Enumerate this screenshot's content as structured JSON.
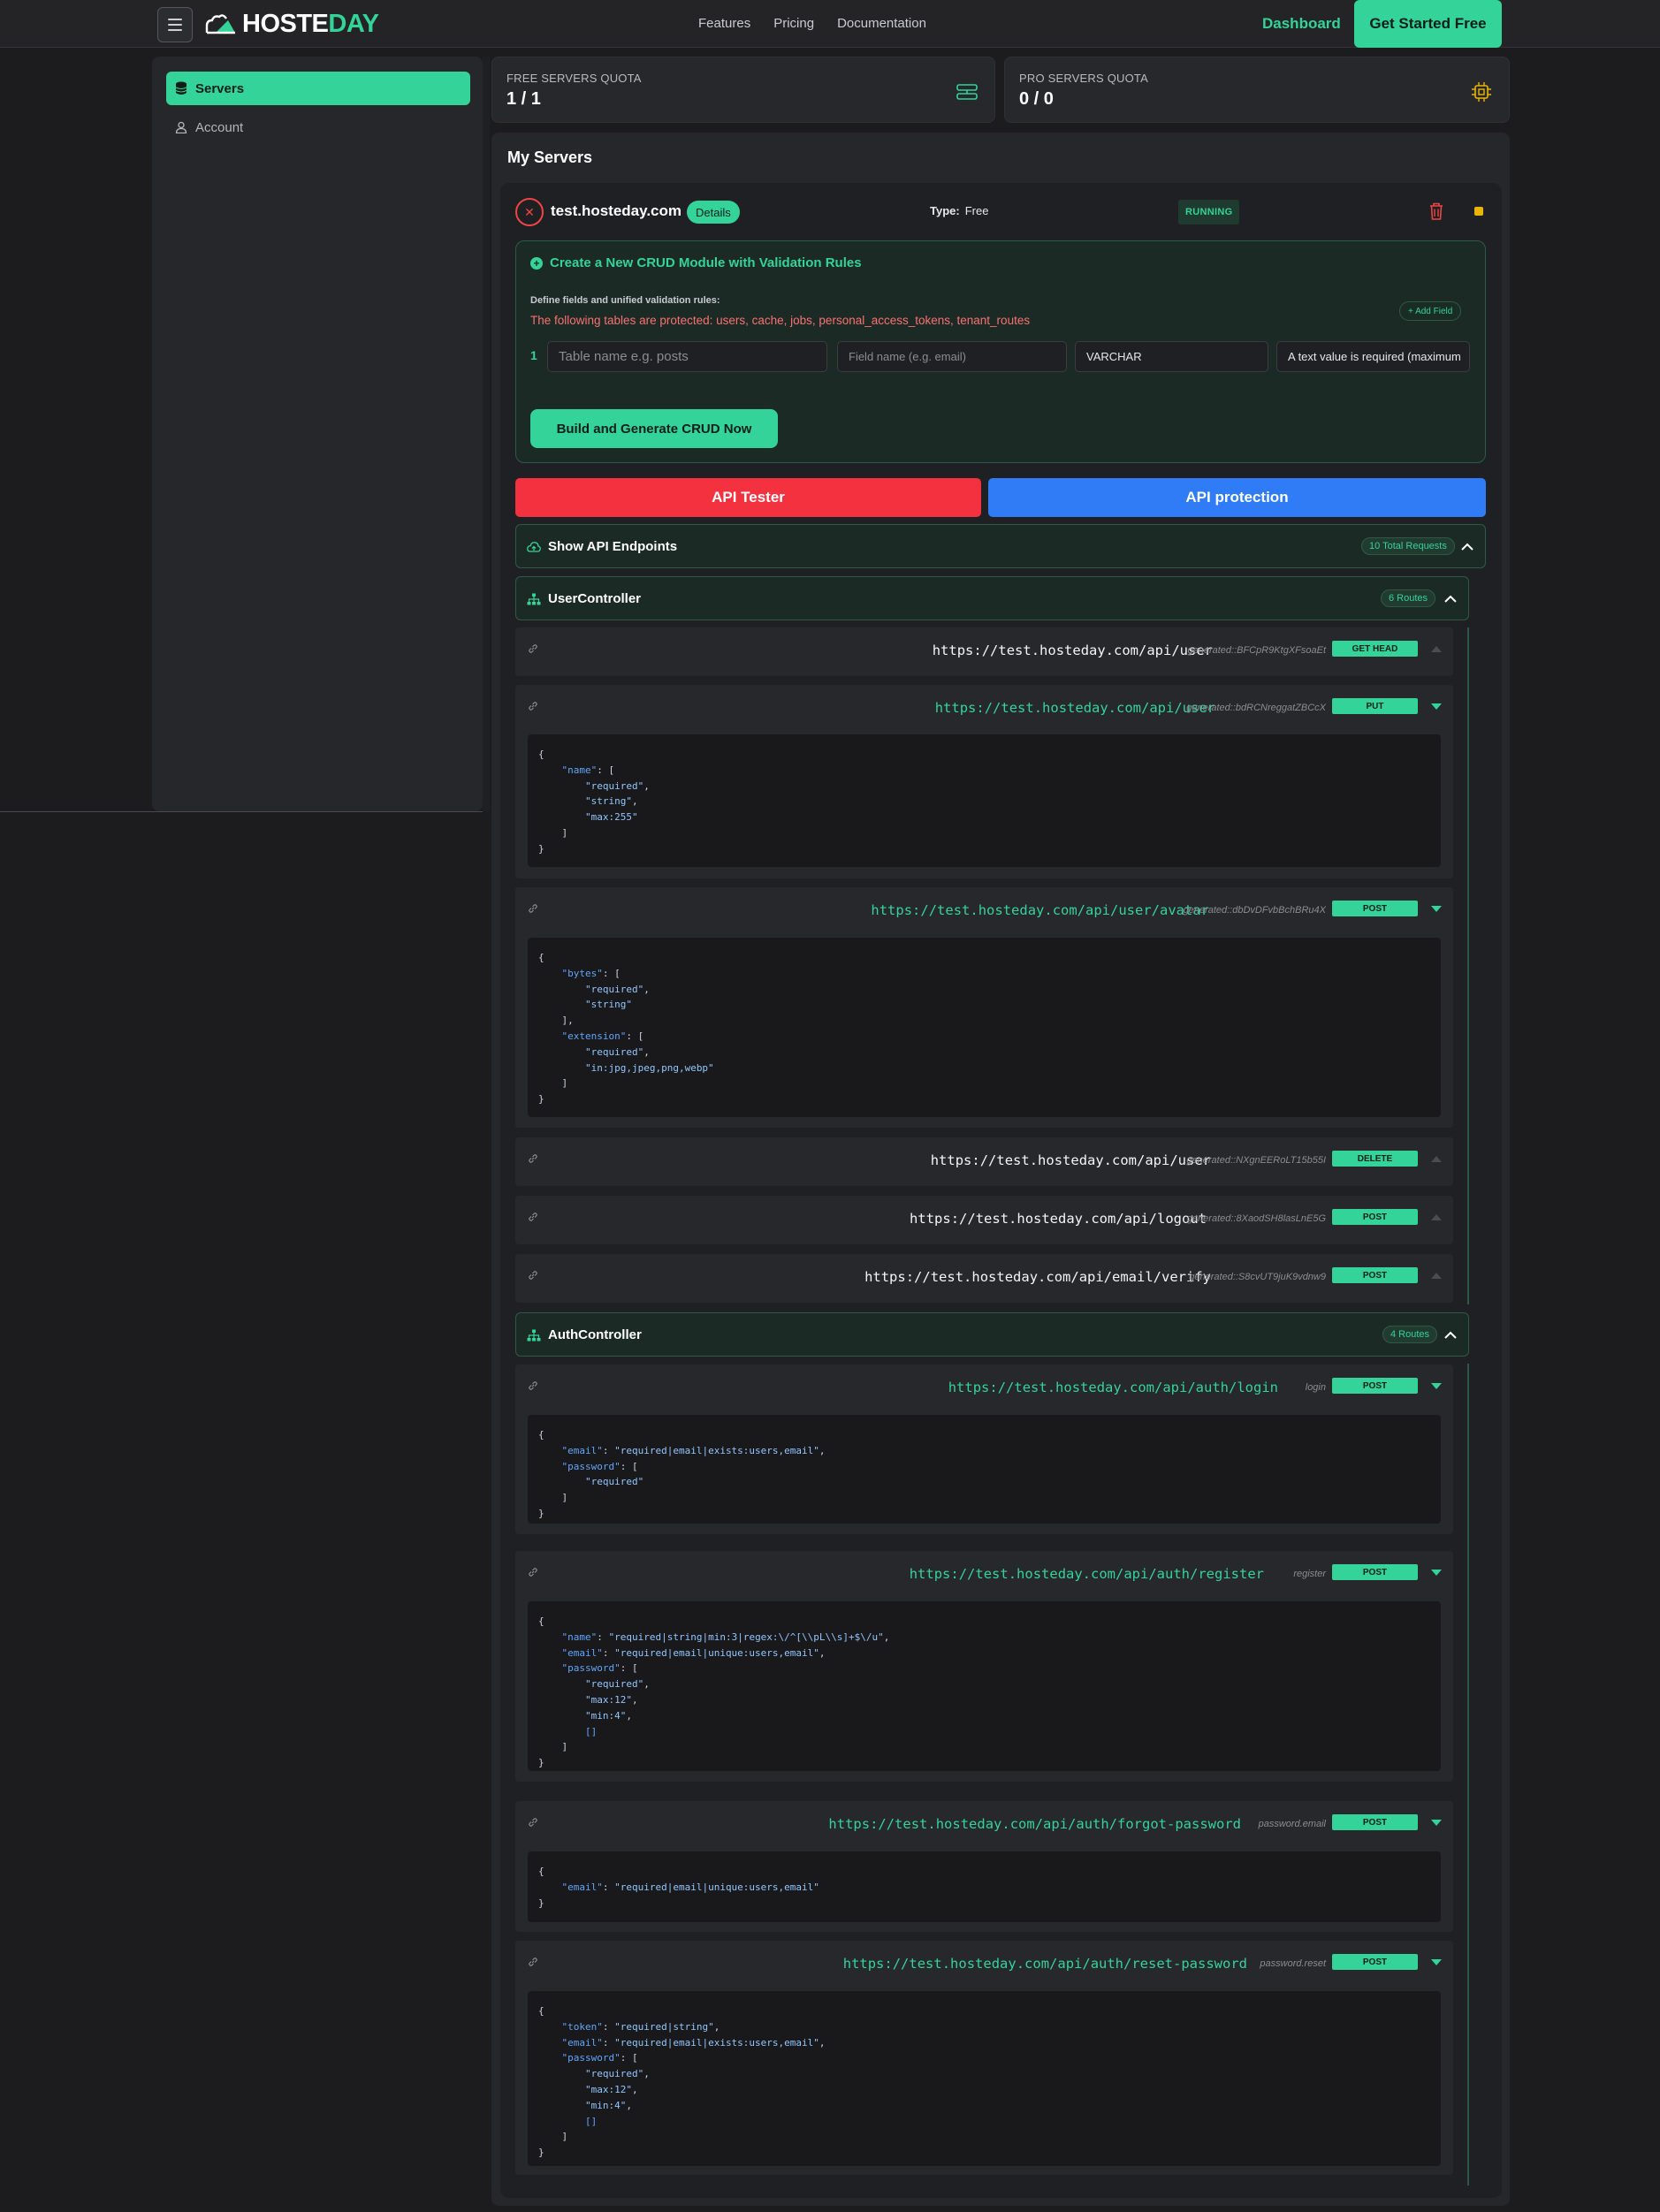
{
  "nav": {
    "logo_white": "HOSTE",
    "logo_accent": "DAY",
    "links": [
      "Features",
      "Pricing",
      "Documentation"
    ],
    "dashboard": "Dashboard",
    "cta": "Get Started Free"
  },
  "sidebar": {
    "items": [
      {
        "label": "Servers",
        "icon": "database-icon",
        "active": true
      },
      {
        "label": "Account",
        "icon": "user-icon",
        "active": false
      }
    ]
  },
  "quota": {
    "free": {
      "label": "FREE SERVERS QUOTA",
      "value": "1 / 1",
      "icon": "server-stack-icon"
    },
    "pro": {
      "label": "PRO SERVERS QUOTA",
      "value": "0 / 0",
      "icon": "cpu-chip-icon"
    }
  },
  "my_servers": {
    "title": "My Servers",
    "server": {
      "name": "test.hosteday.com",
      "details_label": "Details",
      "type_label": "Type:",
      "type_value": "Free",
      "status": "RUNNING"
    }
  },
  "crud": {
    "title": "Create a New CRUD Module with Validation Rules",
    "subtitle": "Define fields and unified validation rules:",
    "warning": "The following tables are protected: users, cache, jobs, personal_access_tokens, tenant_routes",
    "add_field": "+ Add Field",
    "row_number": "1",
    "table_placeholder": "Table name e.g. posts",
    "field_placeholder": "Field name (e.g. email)",
    "type_value": "VARCHAR",
    "rule_value": "A text value is required (maximum",
    "build_button": "Build and Generate CRUD Now"
  },
  "actions": {
    "tester": "API Tester",
    "protection": "API protection"
  },
  "endpoints_section": {
    "title": "Show API Endpoints",
    "badge": "10 Total Requests"
  },
  "controllers": [
    {
      "name": "UserController",
      "badge": "6 Routes",
      "endpoints": [
        {
          "url": "https://test.hosteday.com/api/user",
          "generated": "generated::BFCpR9KtgXFsoaEt",
          "method": "GET HEAD",
          "expanded": false
        },
        {
          "url": "https://test.hosteday.com/api/user",
          "generated": "generated::bdRCNreggatZBCcX",
          "method": "PUT",
          "expanded": true
        },
        {
          "url": "https://test.hosteday.com/api/user/avatar",
          "generated": "generated::dbDvDFvbBchBRu4X",
          "method": "POST",
          "expanded": true
        },
        {
          "url": "https://test.hosteday.com/api/user",
          "generated": "generated::NXgnEERoLT15b55I",
          "method": "DELETE",
          "expanded": false
        },
        {
          "url": "https://test.hosteday.com/api/logout",
          "generated": "generated::8XaodSH8lasLnE5G",
          "method": "POST",
          "expanded": false
        },
        {
          "url": "https://test.hosteday.com/api/email/verify",
          "generated": "generated::S8cvUT9juK9vdnw9",
          "method": "POST",
          "expanded": false
        }
      ]
    },
    {
      "name": "AuthController",
      "badge": "4 Routes",
      "endpoints": [
        {
          "url": "https://test.hosteday.com/api/auth/login",
          "generated": "login",
          "method": "POST",
          "expanded": true
        },
        {
          "url": "https://test.hosteday.com/api/auth/register",
          "generated": "register",
          "method": "POST",
          "expanded": true
        },
        {
          "url": "https://test.hosteday.com/api/auth/forgot-password",
          "generated": "password.email",
          "method": "POST",
          "expanded": true
        },
        {
          "url": "https://test.hosteday.com/api/auth/reset-password",
          "generated": "password.reset",
          "method": "POST",
          "expanded": true
        }
      ]
    }
  ],
  "code": {
    "user_put": [
      [
        [
          "p",
          "{"
        ]
      ],
      [
        [
          "p",
          "    "
        ],
        [
          "k",
          "\"name\""
        ],
        [
          "p",
          ": ["
        ]
      ],
      [
        [
          "p",
          "        "
        ],
        [
          "s",
          "\"required\""
        ],
        [
          "p",
          ","
        ]
      ],
      [
        [
          "p",
          "        "
        ],
        [
          "s",
          "\"string\""
        ],
        [
          "p",
          ","
        ]
      ],
      [
        [
          "p",
          "        "
        ],
        [
          "s",
          "\"max:255\""
        ]
      ],
      [
        [
          "p",
          "    ]"
        ]
      ],
      [
        [
          "p",
          "}"
        ]
      ]
    ],
    "user_avatar": [
      [
        [
          "p",
          "{"
        ]
      ],
      [
        [
          "p",
          "    "
        ],
        [
          "k",
          "\"bytes\""
        ],
        [
          "p",
          ": ["
        ]
      ],
      [
        [
          "p",
          "        "
        ],
        [
          "s",
          "\"required\""
        ],
        [
          "p",
          ","
        ]
      ],
      [
        [
          "p",
          "        "
        ],
        [
          "s",
          "\"string\""
        ]
      ],
      [
        [
          "p",
          "    ],"
        ]
      ],
      [
        [
          "p",
          "    "
        ],
        [
          "k",
          "\"extension\""
        ],
        [
          "p",
          ": ["
        ]
      ],
      [
        [
          "p",
          "        "
        ],
        [
          "s",
          "\"required\""
        ],
        [
          "p",
          ","
        ]
      ],
      [
        [
          "p",
          "        "
        ],
        [
          "s",
          "\"in:jpg,jpeg,png,webp\""
        ]
      ],
      [
        [
          "p",
          "    ]"
        ]
      ],
      [
        [
          "p",
          "}"
        ]
      ]
    ],
    "auth_login": [
      [
        [
          "p",
          "{"
        ]
      ],
      [
        [
          "p",
          "    "
        ],
        [
          "k",
          "\"email\""
        ],
        [
          "p",
          ": "
        ],
        [
          "s",
          "\"required|email|exists:users,email\""
        ],
        [
          "p",
          ","
        ]
      ],
      [
        [
          "p",
          "    "
        ],
        [
          "k",
          "\"password\""
        ],
        [
          "p",
          ": ["
        ]
      ],
      [
        [
          "p",
          "        "
        ],
        [
          "s",
          "\"required\""
        ]
      ],
      [
        [
          "p",
          "    ]"
        ]
      ],
      [
        [
          "p",
          "}"
        ]
      ]
    ],
    "auth_register": [
      [
        [
          "p",
          "{"
        ]
      ],
      [
        [
          "p",
          "    "
        ],
        [
          "k",
          "\"name\""
        ],
        [
          "p",
          ": "
        ],
        [
          "s",
          "\"required|string|min:3|regex:\\/^[\\\\pL\\\\s]+$\\/u\""
        ],
        [
          "p",
          ","
        ]
      ],
      [
        [
          "p",
          "    "
        ],
        [
          "k",
          "\"email\""
        ],
        [
          "p",
          ": "
        ],
        [
          "s",
          "\"required|email|unique:users,email\""
        ],
        [
          "p",
          ","
        ]
      ],
      [
        [
          "p",
          "    "
        ],
        [
          "k",
          "\"password\""
        ],
        [
          "p",
          ": ["
        ]
      ],
      [
        [
          "p",
          "        "
        ],
        [
          "s",
          "\"required\""
        ],
        [
          "p",
          ","
        ]
      ],
      [
        [
          "p",
          "        "
        ],
        [
          "s",
          "\"max:12\""
        ],
        [
          "p",
          ","
        ]
      ],
      [
        [
          "p",
          "        "
        ],
        [
          "s",
          "\"min:4\""
        ],
        [
          "p",
          ","
        ]
      ],
      [
        [
          "p",
          "        "
        ],
        [
          "b",
          "[]"
        ]
      ],
      [
        [
          "p",
          "    ]"
        ]
      ],
      [
        [
          "p",
          "}"
        ]
      ]
    ],
    "auth_forgot": [
      [
        [
          "p",
          "{"
        ]
      ],
      [
        [
          "p",
          "    "
        ],
        [
          "k",
          "\"email\""
        ],
        [
          "p",
          ": "
        ],
        [
          "s",
          "\"required|email|unique:users,email\""
        ]
      ],
      [
        [
          "p",
          "}"
        ]
      ]
    ],
    "auth_reset": [
      [
        [
          "p",
          "{"
        ]
      ],
      [
        [
          "p",
          "    "
        ],
        [
          "k",
          "\"token\""
        ],
        [
          "p",
          ": "
        ],
        [
          "s",
          "\"required|string\""
        ],
        [
          "p",
          ","
        ]
      ],
      [
        [
          "p",
          "    "
        ],
        [
          "k",
          "\"email\""
        ],
        [
          "p",
          ": "
        ],
        [
          "s",
          "\"required|email|exists:users,email\""
        ],
        [
          "p",
          ","
        ]
      ],
      [
        [
          "p",
          "    "
        ],
        [
          "k",
          "\"password\""
        ],
        [
          "p",
          ": ["
        ]
      ],
      [
        [
          "p",
          "        "
        ],
        [
          "s",
          "\"required\""
        ],
        [
          "p",
          ","
        ]
      ],
      [
        [
          "p",
          "        "
        ],
        [
          "s",
          "\"max:12\""
        ],
        [
          "p",
          ","
        ]
      ],
      [
        [
          "p",
          "        "
        ],
        [
          "s",
          "\"min:4\""
        ],
        [
          "p",
          ","
        ]
      ],
      [
        [
          "p",
          "        "
        ],
        [
          "b",
          "[]"
        ]
      ],
      [
        [
          "p",
          "    ]"
        ]
      ],
      [
        [
          "p",
          "}"
        ]
      ]
    ]
  },
  "colors": {
    "accent": "#34d399",
    "danger": "#f4323f",
    "primary": "#2f7cf6",
    "warning": "#eab308"
  }
}
